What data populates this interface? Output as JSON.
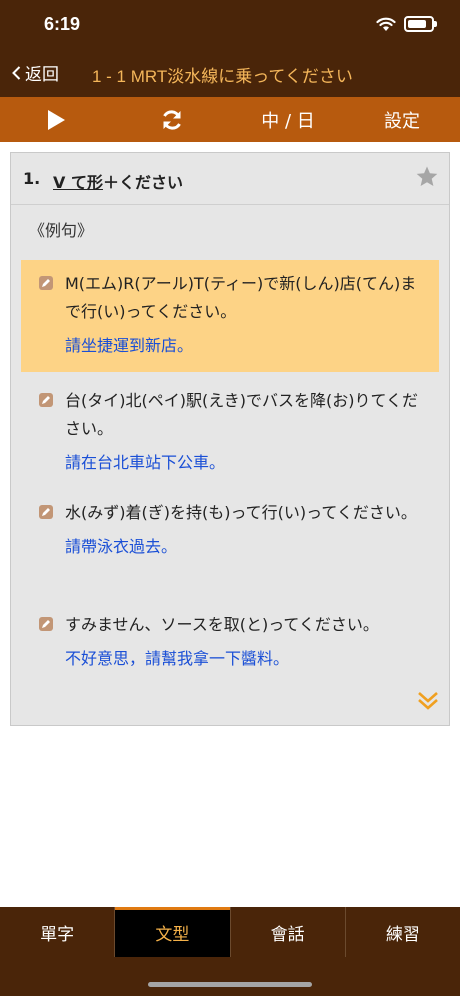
{
  "status": {
    "time": "6:19"
  },
  "nav": {
    "back_label": "返回",
    "title": "1 - 1 MRT淡水線に乗ってください"
  },
  "toolbar": {
    "lang_label": "中 / 日",
    "settings_label": "設定"
  },
  "card": {
    "number": "1.",
    "title_underlined": "V て形",
    "title_rest": "＋ください",
    "section_label": "《例句》",
    "examples": [
      {
        "ja": "M(エム)R(アール)T(ティー)で新(しん)店(てん)まで行(い)ってください。",
        "zh": "請坐捷運到新店。"
      },
      {
        "ja": "台(タイ)北(ペイ)駅(えき)でバスを降(お)りてください。",
        "zh": "請在台北車站下公車。"
      },
      {
        "ja": "水(みず)着(ぎ)を持(も)って行(い)ってください。",
        "zh": "請帶泳衣過去。"
      },
      {
        "ja": "すみません、ソースを取(と)ってください。",
        "zh": "不好意思，請幫我拿一下醬料。"
      }
    ]
  },
  "tabs": [
    {
      "label": "單字"
    },
    {
      "label": "文型"
    },
    {
      "label": "會話"
    },
    {
      "label": "練習"
    }
  ],
  "colors": {
    "header": "#4a2509",
    "toolbar": "#b75a0e",
    "highlight": "#fdd386",
    "accent": "#f5b24a",
    "link": "#1a4fd6"
  }
}
